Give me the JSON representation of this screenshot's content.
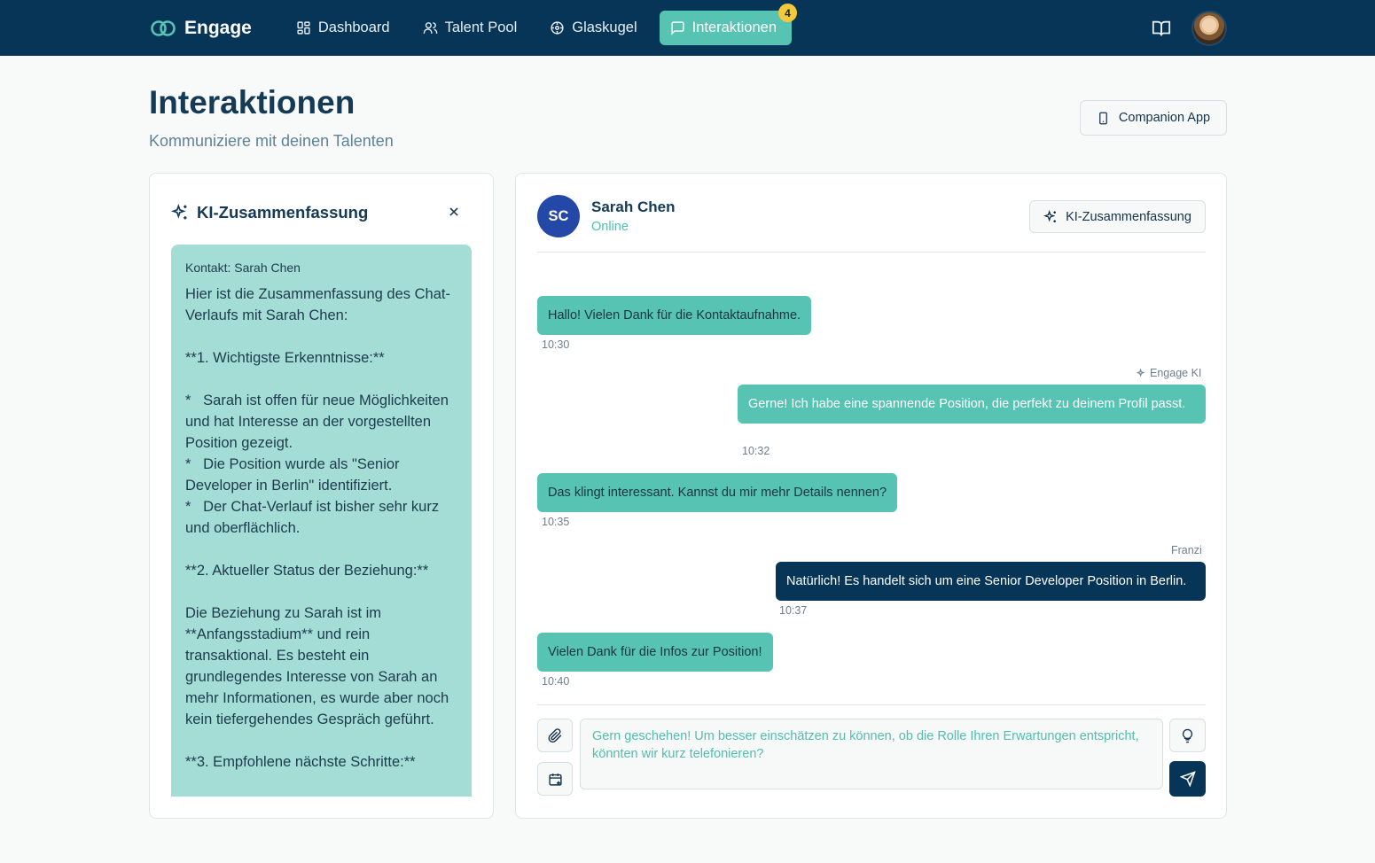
{
  "app": {
    "name": "Engage"
  },
  "nav": {
    "items": [
      {
        "label": "Dashboard",
        "icon": "dashboard-icon"
      },
      {
        "label": "Talent Pool",
        "icon": "users-icon"
      },
      {
        "label": "Glaskugel",
        "icon": "crystal-ball-icon"
      },
      {
        "label": "Interaktionen",
        "icon": "chat-icon",
        "active": true,
        "badge": "4"
      }
    ]
  },
  "header": {
    "title": "Interaktionen",
    "subtitle": "Kommuniziere mit deinen Talenten",
    "companion_label": "Companion App"
  },
  "summary": {
    "title": "KI-Zusammenfassung",
    "contact": "Kontakt: Sarah Chen",
    "text": "Hier ist die Zusammenfassung des Chat-Verlaufs mit Sarah Chen:\n\n**1. Wichtigste Erkenntnisse:**\n\n*   Sarah ist offen für neue Möglichkeiten und hat Interesse an der vorgestellten Position gezeigt.\n*   Die Position wurde als \"Senior Developer in Berlin\" identifiziert.\n*   Der Chat-Verlauf ist bisher sehr kurz und oberflächlich.\n\n**2. Aktueller Status der Beziehung:**\n\nDie Beziehung zu Sarah ist im **Anfangsstadium** und rein transaktional. Es besteht ein grundlegendes Interesse von Sarah an mehr Informationen, es wurde aber noch kein tiefergehendes Gespräch geführt.\n\n**3. Empfohlene nächste Schritte:**"
  },
  "chat": {
    "contact_initials": "SC",
    "contact_name": "Sarah Chen",
    "contact_status": "Online",
    "ki_button_label": "KI-Zusammenfassung",
    "messages": [
      {
        "direction": "in",
        "text": "Hallo! Vielen Dank für die Kontaktaufnahme.",
        "time": "10:30"
      },
      {
        "direction": "out",
        "sender": "Engage KI",
        "text": "Gerne! Ich habe eine spannende Position, die perfekt zu deinem Profil passt.",
        "time": "10:32"
      },
      {
        "direction": "in",
        "text": "Das klingt interessant. Kannst du mir mehr Details nennen?",
        "time": "10:35"
      },
      {
        "direction": "out",
        "sender": "Franzi",
        "text": "Natürlich! Es handelt sich um eine Senior Developer Position in Berlin.",
        "time": "10:37"
      },
      {
        "direction": "in",
        "text": "Vielen Dank für die Infos zur Position!",
        "time": "10:40"
      }
    ],
    "composer_value": "Gern geschehen! Um besser einschätzen zu können, ob die Rolle Ihren Erwartungen entspricht, könnten wir kurz telefonieren?"
  },
  "colors": {
    "navbar": "#063558",
    "accent": "#56c3b3",
    "summary_bg": "#a4ddd6",
    "badge": "#f5c83a",
    "avatar_bg": "#2348a8"
  }
}
